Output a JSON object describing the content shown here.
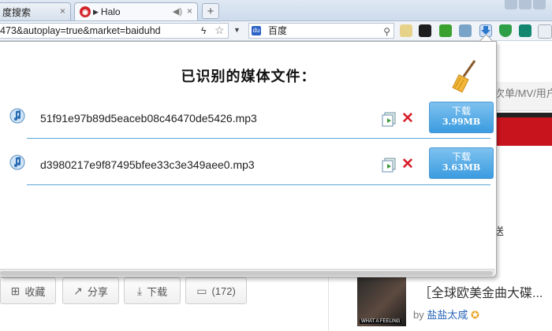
{
  "browser": {
    "tabs": [
      {
        "label": "度搜索",
        "active": false
      },
      {
        "label": "Halo",
        "active": true
      }
    ],
    "new_tab_label": "+",
    "close_glyph": "×",
    "address": "473&autoplay=true&market=baiduhd",
    "search_engine": "百度",
    "extensions": [
      "media-download-icon",
      "shield-icon",
      "vpn-icon",
      "refresh-icon"
    ]
  },
  "popup": {
    "title": "已识别的媒体文件：",
    "files": [
      {
        "name": "51f91e97b89d5eaceb08c46470de5426.mp3",
        "download_label": "下载",
        "size": "3.99MB"
      },
      {
        "name": "d3980217e9f87495bfee33c3e349aee0.mp3",
        "download_label": "下载",
        "size": "3.63MB"
      }
    ],
    "delete_glyph": "✕"
  },
  "background_page": {
    "side_text": "次单/MV/用户",
    "side_song": "送",
    "buttons": [
      {
        "icon": "plus-icon",
        "label": "收藏"
      },
      {
        "icon": "share-icon",
        "label": "分享"
      },
      {
        "icon": "download-icon",
        "label": "下载"
      },
      {
        "icon": "comment-icon",
        "label": "(172)"
      }
    ],
    "recommend": {
      "title": "［全球欧美金曲大碟...",
      "by_prefix": "by",
      "author": "盐盐太咸",
      "album_caption": "WHAT A FEELING"
    }
  },
  "colors": {
    "accent_blue": "#3b9be0",
    "delete_red": "#d8202a",
    "divider_blue": "#5aa7d6",
    "brand_red": "#c8151d"
  }
}
